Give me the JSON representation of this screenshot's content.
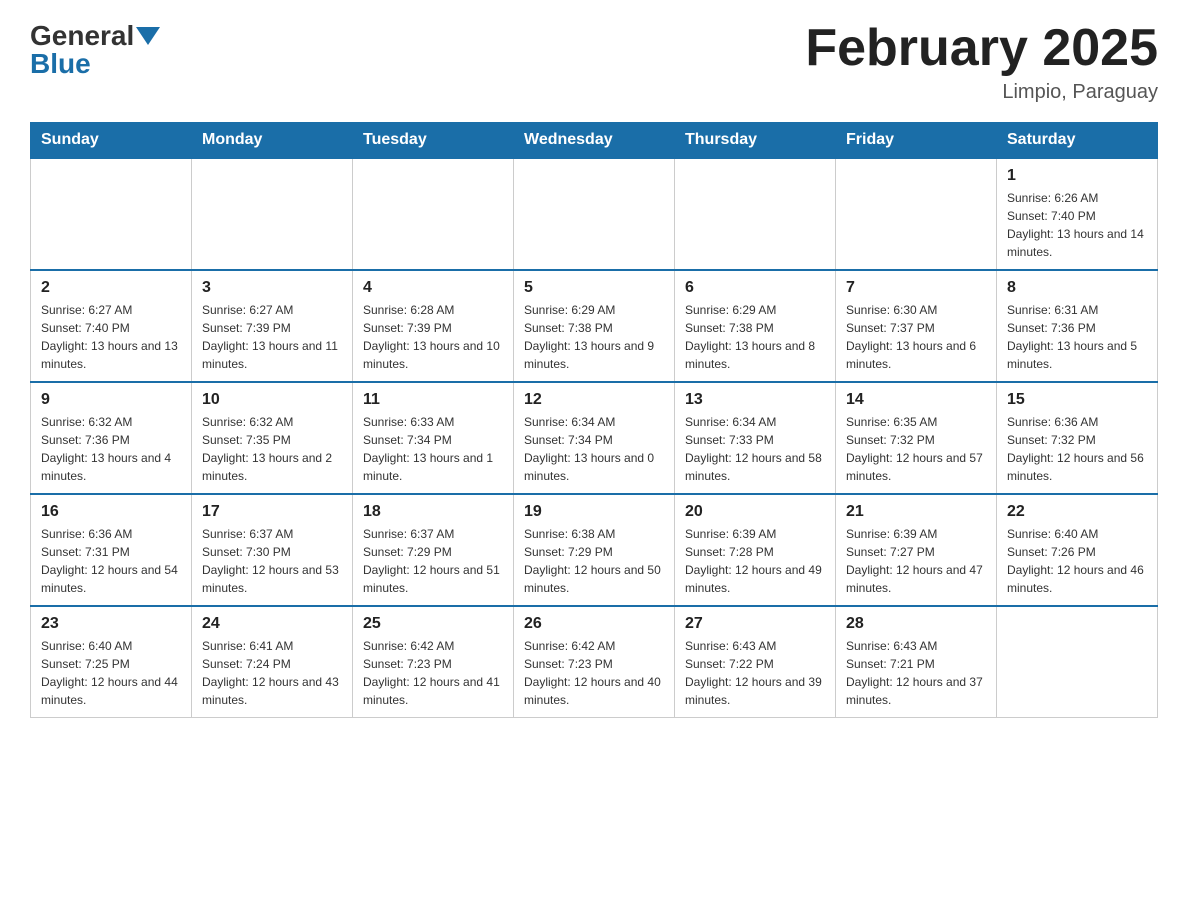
{
  "header": {
    "logo_general": "General",
    "logo_blue": "Blue",
    "month_title": "February 2025",
    "location": "Limpio, Paraguay"
  },
  "days_of_week": [
    "Sunday",
    "Monday",
    "Tuesday",
    "Wednesday",
    "Thursday",
    "Friday",
    "Saturday"
  ],
  "weeks": [
    {
      "days": [
        {
          "number": "",
          "info": ""
        },
        {
          "number": "",
          "info": ""
        },
        {
          "number": "",
          "info": ""
        },
        {
          "number": "",
          "info": ""
        },
        {
          "number": "",
          "info": ""
        },
        {
          "number": "",
          "info": ""
        },
        {
          "number": "1",
          "info": "Sunrise: 6:26 AM\nSunset: 7:40 PM\nDaylight: 13 hours and 14 minutes."
        }
      ]
    },
    {
      "days": [
        {
          "number": "2",
          "info": "Sunrise: 6:27 AM\nSunset: 7:40 PM\nDaylight: 13 hours and 13 minutes."
        },
        {
          "number": "3",
          "info": "Sunrise: 6:27 AM\nSunset: 7:39 PM\nDaylight: 13 hours and 11 minutes."
        },
        {
          "number": "4",
          "info": "Sunrise: 6:28 AM\nSunset: 7:39 PM\nDaylight: 13 hours and 10 minutes."
        },
        {
          "number": "5",
          "info": "Sunrise: 6:29 AM\nSunset: 7:38 PM\nDaylight: 13 hours and 9 minutes."
        },
        {
          "number": "6",
          "info": "Sunrise: 6:29 AM\nSunset: 7:38 PM\nDaylight: 13 hours and 8 minutes."
        },
        {
          "number": "7",
          "info": "Sunrise: 6:30 AM\nSunset: 7:37 PM\nDaylight: 13 hours and 6 minutes."
        },
        {
          "number": "8",
          "info": "Sunrise: 6:31 AM\nSunset: 7:36 PM\nDaylight: 13 hours and 5 minutes."
        }
      ]
    },
    {
      "days": [
        {
          "number": "9",
          "info": "Sunrise: 6:32 AM\nSunset: 7:36 PM\nDaylight: 13 hours and 4 minutes."
        },
        {
          "number": "10",
          "info": "Sunrise: 6:32 AM\nSunset: 7:35 PM\nDaylight: 13 hours and 2 minutes."
        },
        {
          "number": "11",
          "info": "Sunrise: 6:33 AM\nSunset: 7:34 PM\nDaylight: 13 hours and 1 minute."
        },
        {
          "number": "12",
          "info": "Sunrise: 6:34 AM\nSunset: 7:34 PM\nDaylight: 13 hours and 0 minutes."
        },
        {
          "number": "13",
          "info": "Sunrise: 6:34 AM\nSunset: 7:33 PM\nDaylight: 12 hours and 58 minutes."
        },
        {
          "number": "14",
          "info": "Sunrise: 6:35 AM\nSunset: 7:32 PM\nDaylight: 12 hours and 57 minutes."
        },
        {
          "number": "15",
          "info": "Sunrise: 6:36 AM\nSunset: 7:32 PM\nDaylight: 12 hours and 56 minutes."
        }
      ]
    },
    {
      "days": [
        {
          "number": "16",
          "info": "Sunrise: 6:36 AM\nSunset: 7:31 PM\nDaylight: 12 hours and 54 minutes."
        },
        {
          "number": "17",
          "info": "Sunrise: 6:37 AM\nSunset: 7:30 PM\nDaylight: 12 hours and 53 minutes."
        },
        {
          "number": "18",
          "info": "Sunrise: 6:37 AM\nSunset: 7:29 PM\nDaylight: 12 hours and 51 minutes."
        },
        {
          "number": "19",
          "info": "Sunrise: 6:38 AM\nSunset: 7:29 PM\nDaylight: 12 hours and 50 minutes."
        },
        {
          "number": "20",
          "info": "Sunrise: 6:39 AM\nSunset: 7:28 PM\nDaylight: 12 hours and 49 minutes."
        },
        {
          "number": "21",
          "info": "Sunrise: 6:39 AM\nSunset: 7:27 PM\nDaylight: 12 hours and 47 minutes."
        },
        {
          "number": "22",
          "info": "Sunrise: 6:40 AM\nSunset: 7:26 PM\nDaylight: 12 hours and 46 minutes."
        }
      ]
    },
    {
      "days": [
        {
          "number": "23",
          "info": "Sunrise: 6:40 AM\nSunset: 7:25 PM\nDaylight: 12 hours and 44 minutes."
        },
        {
          "number": "24",
          "info": "Sunrise: 6:41 AM\nSunset: 7:24 PM\nDaylight: 12 hours and 43 minutes."
        },
        {
          "number": "25",
          "info": "Sunrise: 6:42 AM\nSunset: 7:23 PM\nDaylight: 12 hours and 41 minutes."
        },
        {
          "number": "26",
          "info": "Sunrise: 6:42 AM\nSunset: 7:23 PM\nDaylight: 12 hours and 40 minutes."
        },
        {
          "number": "27",
          "info": "Sunrise: 6:43 AM\nSunset: 7:22 PM\nDaylight: 12 hours and 39 minutes."
        },
        {
          "number": "28",
          "info": "Sunrise: 6:43 AM\nSunset: 7:21 PM\nDaylight: 12 hours and 37 minutes."
        },
        {
          "number": "",
          "info": ""
        }
      ]
    }
  ]
}
